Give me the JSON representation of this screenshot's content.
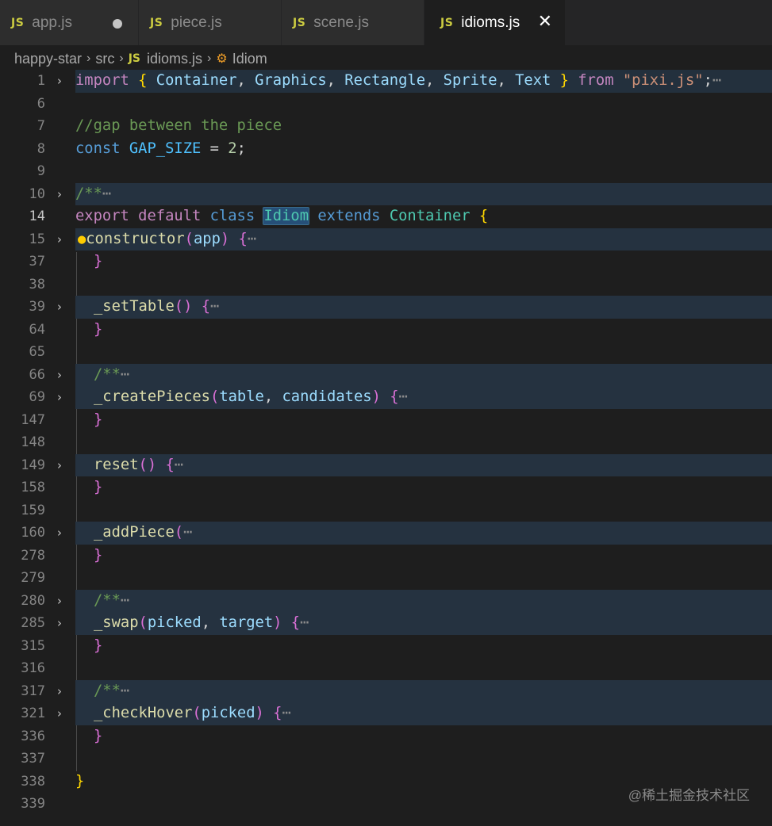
{
  "tabs": [
    {
      "icon": "JS",
      "label": "app.js",
      "modified": true
    },
    {
      "icon": "JS",
      "label": "piece.js"
    },
    {
      "icon": "JS",
      "label": "scene.js"
    },
    {
      "icon": "JS",
      "label": "idioms.js",
      "active": true,
      "close": "✕"
    }
  ],
  "breadcrumb": {
    "folder": "happy-star",
    "src": "src",
    "file_icon": "JS",
    "file": "idioms.js",
    "symbol": "Idiom",
    "sep": "›"
  },
  "lines": {
    "l1": {
      "num": "1"
    },
    "l6": {
      "num": "6"
    },
    "l7": {
      "num": "7"
    },
    "l8": {
      "num": "8"
    },
    "l9": {
      "num": "9"
    },
    "l10": {
      "num": "10"
    },
    "l14": {
      "num": "14"
    },
    "l15": {
      "num": "15"
    },
    "l37": {
      "num": "37"
    },
    "l38": {
      "num": "38"
    },
    "l39": {
      "num": "39"
    },
    "l64": {
      "num": "64"
    },
    "l65": {
      "num": "65"
    },
    "l66": {
      "num": "66"
    },
    "l69": {
      "num": "69"
    },
    "l147": {
      "num": "147"
    },
    "l148": {
      "num": "148"
    },
    "l149": {
      "num": "149"
    },
    "l158": {
      "num": "158"
    },
    "l159": {
      "num": "159"
    },
    "l160": {
      "num": "160"
    },
    "l278": {
      "num": "278"
    },
    "l279": {
      "num": "279"
    },
    "l280": {
      "num": "280"
    },
    "l285": {
      "num": "285"
    },
    "l315": {
      "num": "315"
    },
    "l316": {
      "num": "316"
    },
    "l317": {
      "num": "317"
    },
    "l321": {
      "num": "321"
    },
    "l336": {
      "num": "336"
    },
    "l337": {
      "num": "337"
    },
    "l338": {
      "num": "338"
    },
    "l339": {
      "num": "339"
    }
  },
  "tokens": {
    "import": "import",
    "lb": "{",
    "rb": "}",
    "container": "Container",
    "graphics": "Graphics",
    "rectangle": "Rectangle",
    "sprite": "Sprite",
    "text": "Text",
    "from": "from",
    "pixi": "\"pixi.js\"",
    "semi": ";",
    "comma": ", ",
    "ellipsis": "⋯",
    "comment_gap": "//gap between the piece",
    "const": "const",
    "gap_size": "GAP_SIZE",
    "eq": " = ",
    "two": "2",
    "doc": "/**",
    "export": "export",
    "default": "default",
    "class": "class",
    "idiom": "Idiom",
    "extends": "extends",
    "constructor": "constructor",
    "lp": "(",
    "rp": ")",
    "app": "app",
    "setTable": "_setTable",
    "createPieces": "_createPieces",
    "table": "table",
    "candidates": "candidates",
    "reset": "reset",
    "addPiece": "_addPiece",
    "swap": "_swap",
    "picked": "picked",
    "target": "target",
    "checkHover": "_checkHover"
  },
  "gutter": {
    "fold_icon": "›",
    "bulb_icon": "💡"
  },
  "watermark": "@稀土掘金技术社区"
}
